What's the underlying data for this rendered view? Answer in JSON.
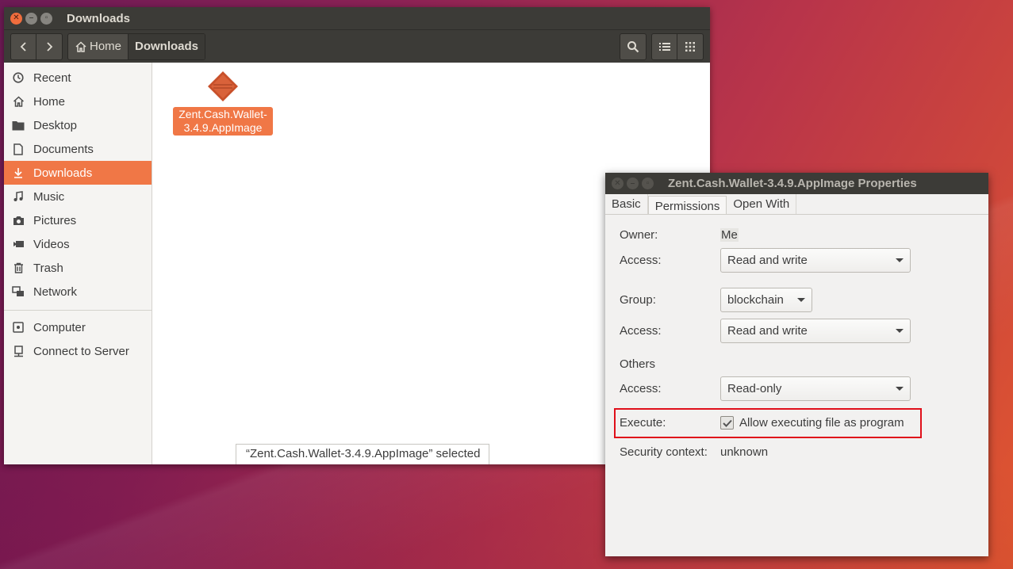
{
  "nautilus": {
    "window_title": "Downloads",
    "breadcrumbs": [
      "Home",
      "Downloads"
    ],
    "sidebar": [
      {
        "label": "Recent",
        "icon": "clock-icon"
      },
      {
        "label": "Home",
        "icon": "home-icon"
      },
      {
        "label": "Desktop",
        "icon": "folder-icon"
      },
      {
        "label": "Documents",
        "icon": "document-icon"
      },
      {
        "label": "Downloads",
        "icon": "download-icon",
        "selected": true
      },
      {
        "label": "Music",
        "icon": "music-icon"
      },
      {
        "label": "Pictures",
        "icon": "camera-icon"
      },
      {
        "label": "Videos",
        "icon": "video-icon"
      },
      {
        "label": "Trash",
        "icon": "trash-icon"
      },
      {
        "label": "Network",
        "icon": "network-icon"
      },
      {
        "label": "Computer",
        "icon": "computer-icon"
      },
      {
        "label": "Connect to Server",
        "icon": "server-icon"
      }
    ],
    "file": {
      "name_line1": "Zent.Cash.Wallet-",
      "name_line2": "3.4.9.AppImage"
    },
    "status": "“Zent.Cash.Wallet-3.4.9.AppImage” selected"
  },
  "properties": {
    "title": "Zent.Cash.Wallet-3.4.9.AppImage Properties",
    "tabs": [
      "Basic",
      "Permissions",
      "Open With"
    ],
    "active_tab": "Permissions",
    "owner_label": "Owner:",
    "owner_value": "Me",
    "access_label": "Access:",
    "owner_access": "Read and write",
    "group_label": "Group:",
    "group_value": "blockchain",
    "group_access": "Read and write",
    "others_label": "Others",
    "others_access": "Read-only",
    "execute_label": "Execute:",
    "execute_checkbox_label": "Allow executing file as program",
    "execute_checked": true,
    "security_label": "Security context:",
    "security_value": "unknown"
  },
  "colors": {
    "accent": "#f07746",
    "highlight_box": "#e0101a",
    "titlebar": "#3c3b37"
  }
}
